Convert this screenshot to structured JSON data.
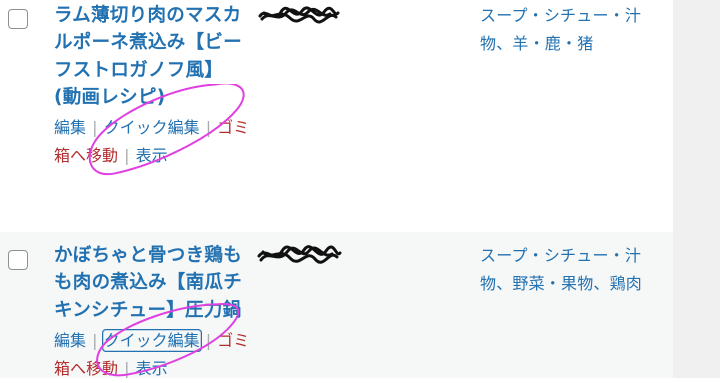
{
  "posts": [
    {
      "title": "ラム薄切り肉のマスカルポーネ煮込み【ビーフストロガノフ風】(動画レシピ)",
      "categories": "スープ・シチュー・汁物、羊・鹿・猪",
      "row_actions": {
        "edit": "編集",
        "quick_edit": "クイック編集",
        "trash": "ゴミ箱へ移動",
        "view": "表示",
        "separator": "|"
      }
    },
    {
      "title": "かぼちゃと骨つき鶏もも肉の煮込み【南瓜チキンシチュー】圧力鍋",
      "categories": "スープ・シチュー・汁物、野菜・果物、鶏肉",
      "row_actions": {
        "edit": "編集",
        "quick_edit": "クイック編集",
        "trash": "ゴミ箱へ移動",
        "view": "表示",
        "separator": "|"
      }
    }
  ],
  "colors": {
    "link": "#2271b1",
    "trash": "#b32d2e",
    "separator": "#a7aaad",
    "alt_row_bg": "#f6f7f7",
    "annotation_circle": "#e040e0",
    "redaction": "#111111"
  },
  "icons": {
    "author_cell": "redaction-scribble",
    "annotation": "hand-drawn-ellipse"
  }
}
